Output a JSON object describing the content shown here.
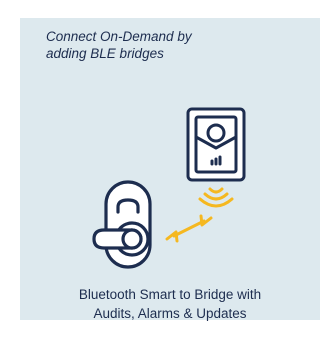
{
  "card": {
    "heading_line1": "Connect On-Demand by",
    "heading_line2": "adding BLE bridges",
    "caption_line1": "Bluetooth Smart to Bridge with",
    "caption_line2": "Audits, Alarms & Updates"
  },
  "icons": {
    "bridge": "ble-bridge-icon",
    "signal": "wireless-signal-icon",
    "arrow": "double-arrow-icon",
    "lock": "door-lock-icon"
  },
  "colors": {
    "background": "#dde9ee",
    "navy": "#1d2d4f",
    "accent": "#f5b820"
  }
}
